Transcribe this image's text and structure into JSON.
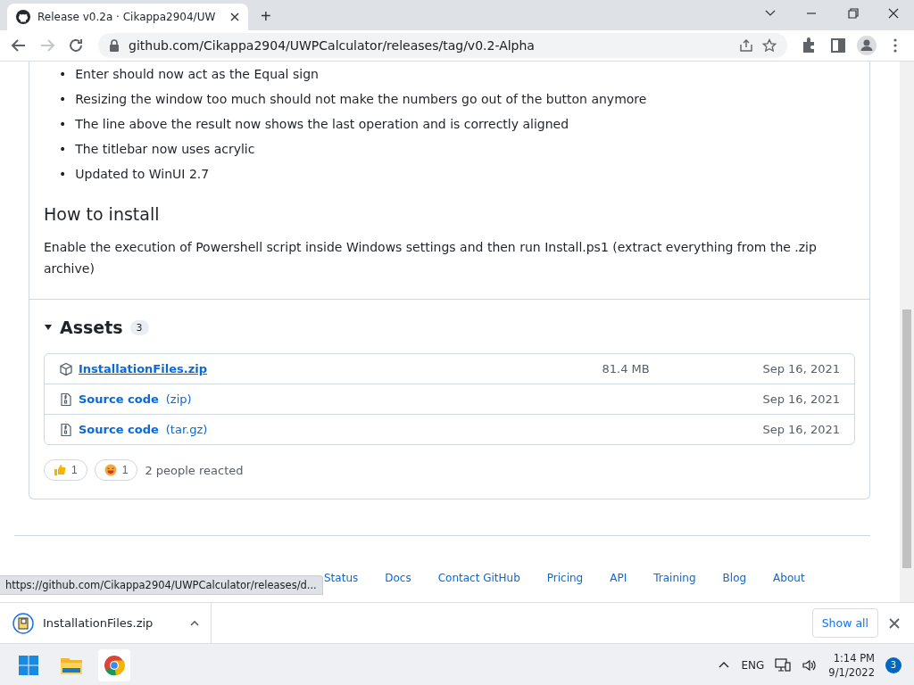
{
  "browser": {
    "tab": {
      "title": "Release v0.2a · Cikappa2904/UW",
      "selected": true
    },
    "new_tab": "+",
    "url": "github.com/Cikappa2904/UWPCalculator/releases/tag/v0.2-Alpha"
  },
  "release": {
    "changes": [
      {
        "marker": "•",
        "text": "Enter should now act as the Equal sign"
      },
      {
        "marker": "•",
        "text": "Resizing the window too much should not make the numbers go out of the button anymore"
      },
      {
        "marker": "•",
        "text": "The line above the result now shows the last operation and is correctly aligned"
      },
      {
        "marker": "•",
        "text": "The titlebar now uses acrylic"
      },
      {
        "marker": "•",
        "text": "Updated to WinUI 2.7"
      }
    ],
    "install_heading": "How to install",
    "install_text": "Enable the execution of Powershell script inside Windows settings and then run Install.ps1 (extract everything from the .zip archive)",
    "assets": {
      "title": "Assets",
      "count": "3",
      "expanded": true,
      "items": [
        {
          "kind": "package",
          "name": "InstallationFiles.zip",
          "size": "81.4 MB",
          "date": "Sep 16, 2021"
        },
        {
          "kind": "source",
          "name": "Source code",
          "suffix": "(zip)",
          "date": "Sep 16, 2021"
        },
        {
          "kind": "source",
          "name": "Source code",
          "suffix": "(tar.gz)",
          "date": "Sep 16, 2021"
        }
      ]
    },
    "reactions": [
      {
        "kind": "thumbs",
        "count": "1"
      },
      {
        "kind": "laugh",
        "count": "1"
      }
    ],
    "reacted": "2 people reacted"
  },
  "footer_links": [
    "Status",
    "Docs",
    "Contact GitHub",
    "Pricing",
    "API",
    "Training",
    "Blog",
    "About"
  ],
  "status_url": "https://github.com/Cikappa2904/UWPCalculator/releases/d...",
  "download_shelf": {
    "file": "InstallationFiles.zip",
    "show_all": "Show all"
  },
  "taskbar": {
    "language": "ENG",
    "time": "1:14 PM",
    "date": "9/1/2022",
    "notifications": "3"
  }
}
